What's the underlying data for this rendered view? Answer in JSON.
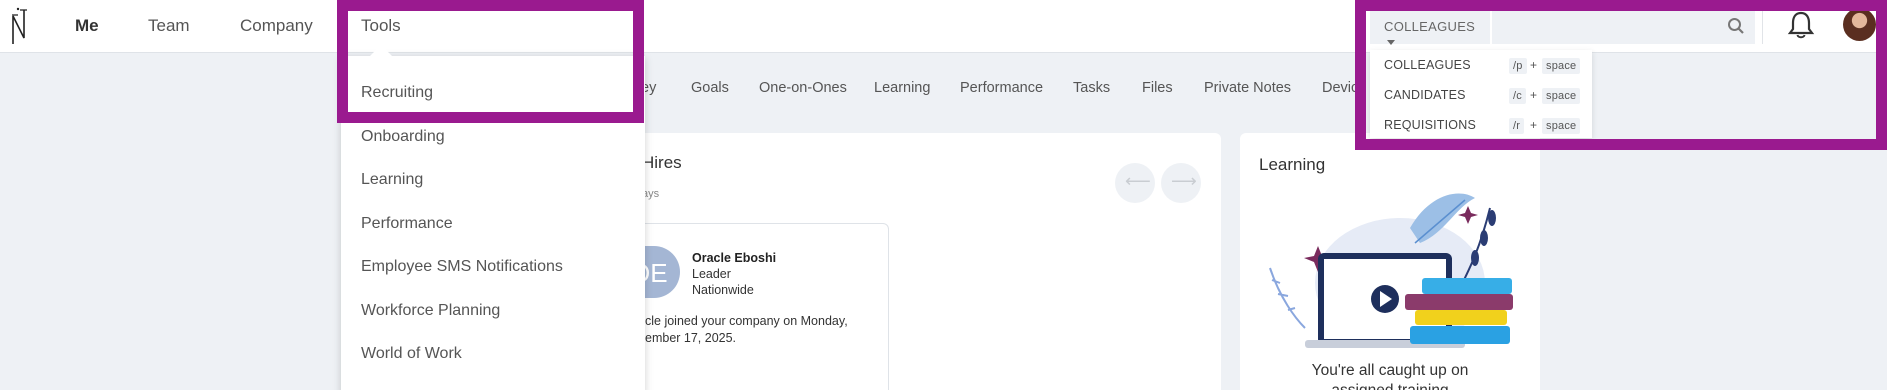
{
  "nav": {
    "me": "Me",
    "team": "Team",
    "company": "Company",
    "tools": "Tools"
  },
  "search": {
    "type_label": "COLLEAGUES",
    "placeholder": "",
    "options": [
      {
        "label": "COLLEAGUES",
        "key": "/p",
        "plus": "+",
        "space": "space"
      },
      {
        "label": "CANDIDATES",
        "key": "/c",
        "plus": "+",
        "space": "space"
      },
      {
        "label": "REQUISITIONS",
        "key": "/r",
        "plus": "+",
        "space": "space"
      }
    ]
  },
  "tools_menu": {
    "items": [
      "Recruiting",
      "Onboarding",
      "Learning",
      "Performance",
      "Employee SMS Notifications",
      "Workforce Planning",
      "World of Work"
    ]
  },
  "subtabs": [
    "ey",
    "Goals",
    "One-on-Ones",
    "Learning",
    "Performance",
    "Tasks",
    "Files",
    "Private Notes",
    "Devic"
  ],
  "new_hires": {
    "title_partial": "Hires",
    "subtitle_partial": "ays",
    "person": {
      "initials": "OE",
      "name": "Oracle Eboshi",
      "role": "Leader",
      "location": "Nationwide",
      "message_line1": "cle joined your company on Monday,",
      "message_line2": "ember 17, 2025."
    },
    "prev_arrow": "⟵",
    "next_arrow": "⟶"
  },
  "learning_card": {
    "title": "Learning",
    "caption_line1": "You're all caught up on",
    "caption_line2": "assigned training"
  },
  "colors": {
    "highlight": "#9a1a8f",
    "background": "#eef1f5",
    "avatar_initials_bg": "#a4b6d4"
  },
  "icons": {
    "logo": "nh-logo",
    "search": "search-icon",
    "bell": "bell-icon"
  }
}
